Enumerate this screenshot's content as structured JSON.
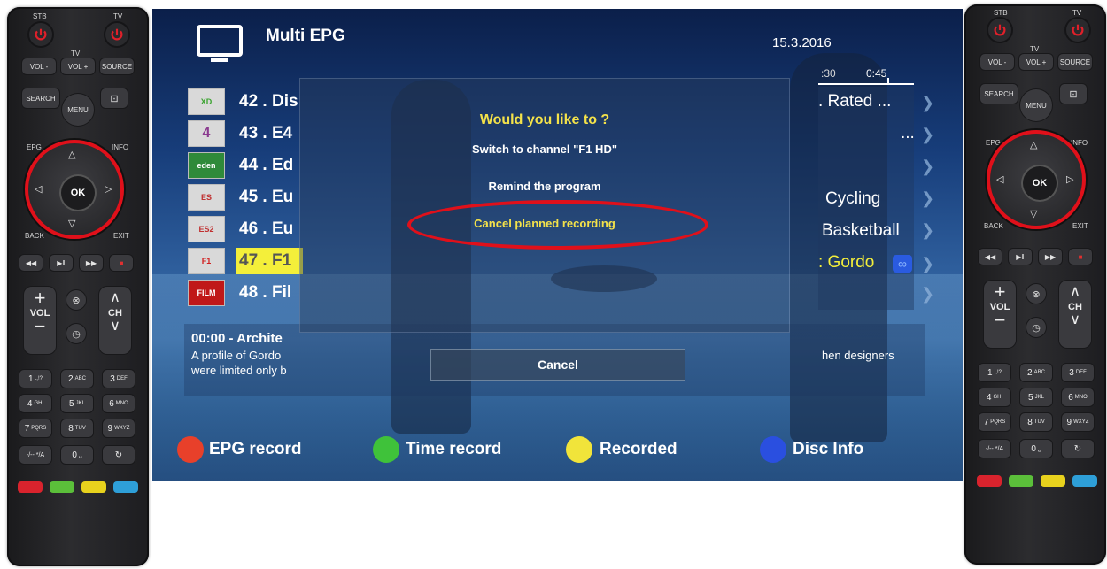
{
  "remote": {
    "stb_label": "STB",
    "tv_label": "TV",
    "tv_group_label": "TV",
    "vol_minus": "VOL -",
    "vol_plus": "VOL +",
    "source": "SOURCE",
    "search": "SEARCH",
    "menu": "MENU",
    "epg": "EPG",
    "info": "INFO",
    "back": "BACK",
    "exit": "EXIT",
    "ok": "OK",
    "vol": "VOL",
    "ch": "CH",
    "keys": [
      {
        "n": "1",
        "s": ".,!?"
      },
      {
        "n": "2",
        "s": "ABC"
      },
      {
        "n": "3",
        "s": "DEF"
      },
      {
        "n": "4",
        "s": "GHI"
      },
      {
        "n": "5",
        "s": "JKL"
      },
      {
        "n": "6",
        "s": "MNO"
      },
      {
        "n": "7",
        "s": "PQRS"
      },
      {
        "n": "8",
        "s": "TUV"
      },
      {
        "n": "9",
        "s": "WXYZ"
      }
    ],
    "key_dash": "-/-- */A",
    "key_zero": "0",
    "key_zero_sub": "␣",
    "color_keys": [
      "#d9232d",
      "#5bbf3a",
      "#e8d21d",
      "#2e9fd8"
    ]
  },
  "tv": {
    "title": "Multi EPG",
    "date": "15.3.2016",
    "timeline": [
      ":30",
      "0:45"
    ],
    "channels": [
      {
        "label": "42 . Dis",
        "logo": "XD",
        "logo_color": "#3aa32f"
      },
      {
        "label": "43 . E4",
        "logo": "4",
        "logo_color": "#8a3b8f"
      },
      {
        "label": "44 . Ed",
        "logo": "eden",
        "logo_color": "#2f8a3a"
      },
      {
        "label": "45 . Eu",
        "logo": "ES",
        "logo_color": "#c03030"
      },
      {
        "label": "46 . Eu",
        "logo": "ES2",
        "logo_color": "#c03030"
      },
      {
        "label": "47 . F1",
        "logo": "F1",
        "logo_color": "#d02020"
      },
      {
        "label": "48 . Fil",
        "logo": "FILM",
        "logo_color": "#c01818"
      }
    ],
    "programs": [
      ". Rated ...",
      "...",
      "",
      "Cycling",
      "Basketball",
      ": Gordo",
      ""
    ],
    "detail_title": "00:00  -  Archite",
    "detail_text_1": "A profile of Gordo",
    "detail_text_2": "were limited only b",
    "detail_right": "hen designers",
    "dialog": {
      "question": "Would you like to ?",
      "option_switch": "Switch to channel \"F1 HD\"",
      "option_remind": "Remind the program",
      "option_cancel_recording": "Cancel planned recording",
      "cancel": "Cancel"
    },
    "footer": [
      {
        "label": "EPG record",
        "color": "#e8402a"
      },
      {
        "label": "Time record",
        "color": "#3fc23a"
      },
      {
        "label": "Recorded",
        "color": "#f1e43a"
      },
      {
        "label": "Disc Info",
        "color": "#2a4fe0"
      }
    ]
  },
  "colors": {
    "highlight_ring": "#e0101a",
    "question_text": "#f4e24a",
    "option_cancel_text": "#f4e24a",
    "selected_row": "#f4ef3a"
  }
}
